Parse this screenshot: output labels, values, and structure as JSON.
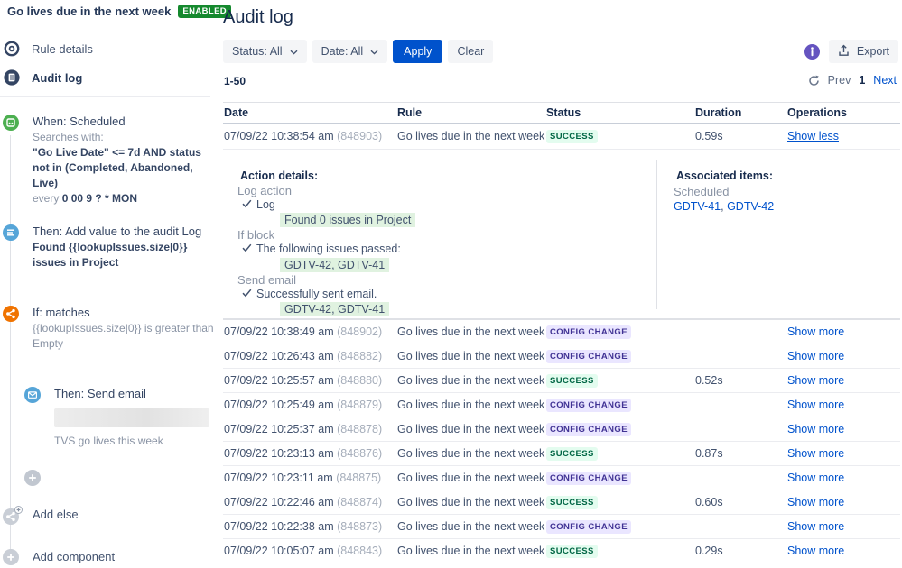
{
  "sidebar": {
    "title": "Go lives due in the next week",
    "badge": "ENABLED",
    "nav": {
      "rule_details": "Rule details",
      "audit_log": "Audit log"
    },
    "chain": {
      "when": {
        "title": "When: Scheduled",
        "searches_label": "Searches with:",
        "jql": "\"Go Live Date\" <= 7d AND status not in (Completed, Abandoned, Live)",
        "every_prefix": "every ",
        "cron": "0 00 9 ? * MON"
      },
      "then_audit": {
        "title": "Then: Add value to the audit Log",
        "desc": "Found {{lookupIssues.size|0}} issues in Project"
      },
      "if_cond": {
        "title": "If: matches",
        "desc": "{{lookupIssues.size|0}} is greater than Empty"
      },
      "send_email": {
        "title": "Then: Send email",
        "subject": "TVS go lives this week"
      },
      "add_else": "Add else",
      "add_component": "Add component"
    }
  },
  "main": {
    "title": "Audit log",
    "filters": {
      "status": "Status: All",
      "date": "Date: All",
      "apply": "Apply",
      "clear": "Clear"
    },
    "export_label": "Export",
    "range": "1-50",
    "pagination": {
      "prev": "Prev",
      "page": "1",
      "next": "Next"
    },
    "table": {
      "headers": [
        "Date",
        "Rule",
        "Status",
        "Duration",
        "Operations"
      ],
      "rows": [
        {
          "date": "07/09/22 10:38:54 am",
          "id": "(848903)",
          "rule": "Go lives due in the next week",
          "status": "SUCCESS",
          "variant": "success",
          "duration": "0.59s",
          "operation": "Show less"
        },
        {
          "date": "07/09/22 10:38:49 am",
          "id": "(848902)",
          "rule": "Go lives due in the next week",
          "status": "CONFIG CHANGE",
          "variant": "config",
          "duration": "",
          "operation": "Show more"
        },
        {
          "date": "07/09/22 10:26:43 am",
          "id": "(848882)",
          "rule": "Go lives due in the next week",
          "status": "CONFIG CHANGE",
          "variant": "config",
          "duration": "",
          "operation": "Show more"
        },
        {
          "date": "07/09/22 10:25:57 am",
          "id": "(848880)",
          "rule": "Go lives due in the next week",
          "status": "SUCCESS",
          "variant": "success",
          "duration": "0.52s",
          "operation": "Show more"
        },
        {
          "date": "07/09/22 10:25:49 am",
          "id": "(848879)",
          "rule": "Go lives due in the next week",
          "status": "CONFIG CHANGE",
          "variant": "config",
          "duration": "",
          "operation": "Show more"
        },
        {
          "date": "07/09/22 10:25:37 am",
          "id": "(848878)",
          "rule": "Go lives due in the next week",
          "status": "CONFIG CHANGE",
          "variant": "config",
          "duration": "",
          "operation": "Show more"
        },
        {
          "date": "07/09/22 10:23:13 am",
          "id": "(848876)",
          "rule": "Go lives due in the next week",
          "status": "SUCCESS",
          "variant": "success",
          "duration": "0.87s",
          "operation": "Show more"
        },
        {
          "date": "07/09/22 10:23:11 am",
          "id": "(848875)",
          "rule": "Go lives due in the next week",
          "status": "CONFIG CHANGE",
          "variant": "config",
          "duration": "",
          "operation": "Show more"
        },
        {
          "date": "07/09/22 10:22:46 am",
          "id": "(848874)",
          "rule": "Go lives due in the next week",
          "status": "SUCCESS",
          "variant": "success",
          "duration": "0.60s",
          "operation": "Show more"
        },
        {
          "date": "07/09/22 10:22:38 am",
          "id": "(848873)",
          "rule": "Go lives due in the next week",
          "status": "CONFIG CHANGE",
          "variant": "config",
          "duration": "",
          "operation": "Show more"
        },
        {
          "date": "07/09/22 10:05:07 am",
          "id": "(848843)",
          "rule": "Go lives due in the next week",
          "status": "SUCCESS",
          "variant": "success",
          "duration": "0.29s",
          "operation": "Show more"
        }
      ],
      "detail": {
        "action_label": "Action details:",
        "sections": [
          {
            "group": "Log action",
            "result": "Log",
            "highlight": "Found 0 issues in Project"
          },
          {
            "group": "If block",
            "result": "The following issues passed:",
            "highlight": "GDTV-42, GDTV-41"
          },
          {
            "group": "Send email",
            "result": "Successfully sent email.",
            "highlight": "GDTV-42, GDTV-41"
          }
        ],
        "associated": {
          "label": "Associated items:",
          "type": "Scheduled",
          "link1": "GDTV-41",
          "sep": ", ",
          "link2": "GDTV-42"
        }
      }
    }
  },
  "icons": [
    "info-ring-icon",
    "audit-log-icon",
    "calendar-trigger-icon",
    "log-action-icon",
    "branch-condition-icon",
    "envelope-icon",
    "plus-icon",
    "branch-add-icon",
    "info-icon",
    "export-icon",
    "refresh-icon",
    "chevron-down-icon",
    "check-icon"
  ],
  "colors": {
    "accent_blue": "#0052CC",
    "enabled_green": "#15892E",
    "success_bg": "#E3FCEF",
    "success_text": "#006644",
    "config_bg": "#EAE6FF",
    "config_text": "#403294",
    "trigger_green": "#4CAF50",
    "action_blue": "#56A5D8",
    "condition_orange": "#F07300",
    "info_purple": "#6554C0",
    "detail_highlight": "#E0F2E0"
  }
}
